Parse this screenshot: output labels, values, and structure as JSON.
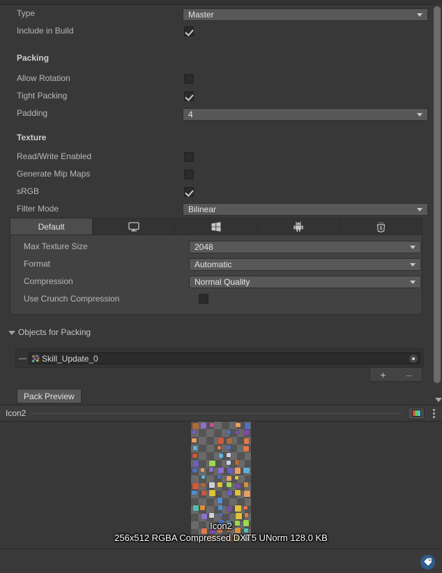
{
  "inspector": {
    "fields": [
      {
        "label": "Type",
        "control": "dropdown",
        "value": "Master"
      },
      {
        "label": "Include in Build",
        "control": "checkbox",
        "value": "true"
      }
    ],
    "packing_header": "Packing",
    "packing_fields": [
      {
        "label": "Allow Rotation",
        "control": "checkbox",
        "value": "false"
      },
      {
        "label": "Tight Packing",
        "control": "checkbox",
        "value": "true"
      },
      {
        "label": "Padding",
        "control": "dropdown",
        "value": "4"
      }
    ],
    "texture_header": "Texture",
    "texture_fields": [
      {
        "label": "Read/Write Enabled",
        "control": "checkbox",
        "value": "false"
      },
      {
        "label": "Generate Mip Maps",
        "control": "checkbox",
        "value": "false"
      },
      {
        "label": "sRGB",
        "control": "checkbox",
        "value": "true"
      },
      {
        "label": "Filter Mode",
        "control": "dropdown",
        "value": "Bilinear"
      }
    ],
    "platform_tabs": [
      {
        "label": "Default",
        "icon": "text",
        "active": "true"
      },
      {
        "label": "",
        "icon": "monitor-icon",
        "active": "false"
      },
      {
        "label": "",
        "icon": "windows-icon",
        "active": "false"
      },
      {
        "label": "",
        "icon": "android-icon",
        "active": "false"
      },
      {
        "label": "",
        "icon": "html5-icon",
        "active": "false"
      }
    ],
    "platform_fields": [
      {
        "label": "Max Texture Size",
        "control": "dropdown",
        "value": "2048"
      },
      {
        "label": "Format",
        "control": "dropdown",
        "value": "Automatic"
      },
      {
        "label": "Compression",
        "control": "dropdown",
        "value": "Normal Quality"
      },
      {
        "label": "Use Crunch Compression",
        "control": "checkbox",
        "value": "false"
      }
    ],
    "objects_foldout": "Objects for Packing",
    "objects": [
      {
        "name": "Skill_Update_0"
      }
    ],
    "add_label": "+",
    "remove_label": "–",
    "pack_preview_label": "Pack Preview"
  },
  "preview": {
    "title": "Icon2",
    "overlay_name": "Icon2",
    "overlay_info": "256x512 RGBA Compressed DXT5 UNorm   128.0 KB",
    "rgb_button": "rgb-channels-icon",
    "menu_button": "kebab-menu-icon"
  },
  "bottom_bar": {
    "badge": "asset-label-tag-icon",
    "badge_color": "#2f5d8e"
  }
}
